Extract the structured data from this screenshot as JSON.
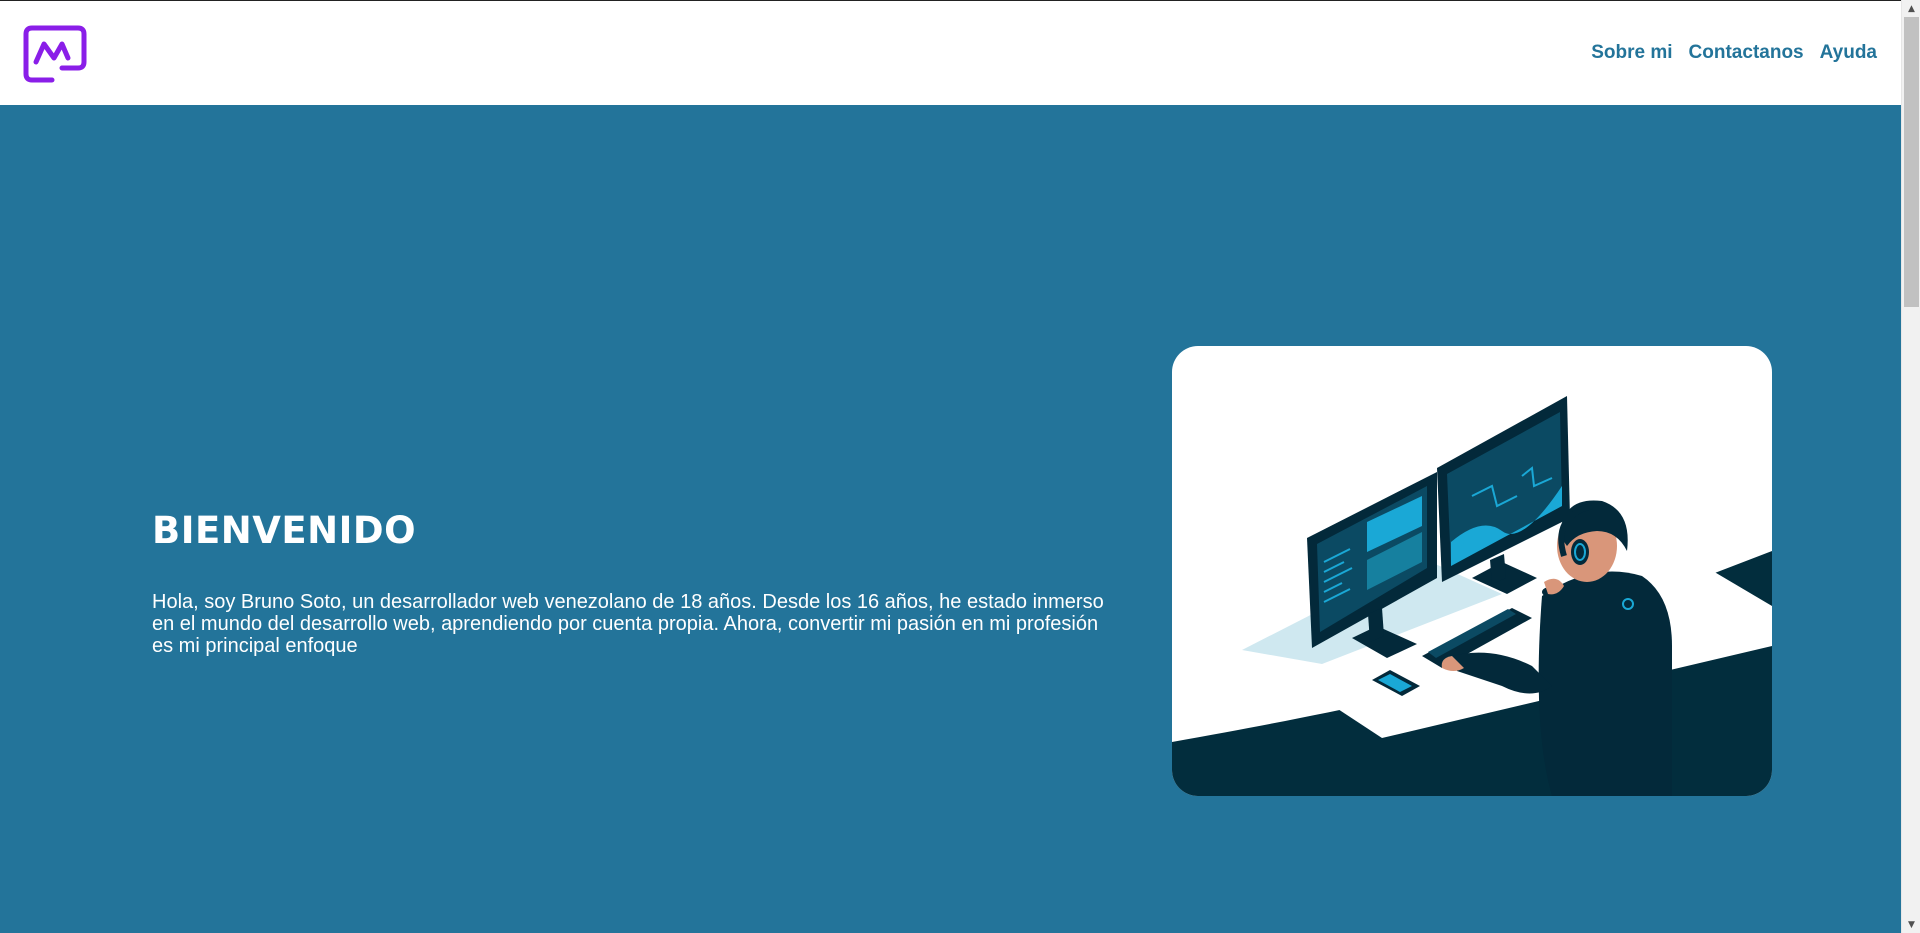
{
  "header": {
    "logo_icon": "brand-logo-icon",
    "nav": [
      {
        "label": "Sobre mi"
      },
      {
        "label": "Contactanos"
      },
      {
        "label": "Ayuda"
      }
    ]
  },
  "hero": {
    "title": "BIENVENIDO",
    "description": "Hola, soy Bruno Soto, un desarrollador web venezolano de 18 años. Desde los 16 años, he estado inmerso en el mundo del desarrollo web, aprendiendo por cuenta propia. Ahora, convertir mi pasión en mi profesión es mi principal enfoque",
    "illustration_icon": "developer-at-desk-illustration"
  },
  "colors": {
    "accent": "#23749a",
    "logo": "#8a1ee8",
    "illustration_dark": "#022d3d",
    "illustration_cyan": "#1aa8d6"
  }
}
